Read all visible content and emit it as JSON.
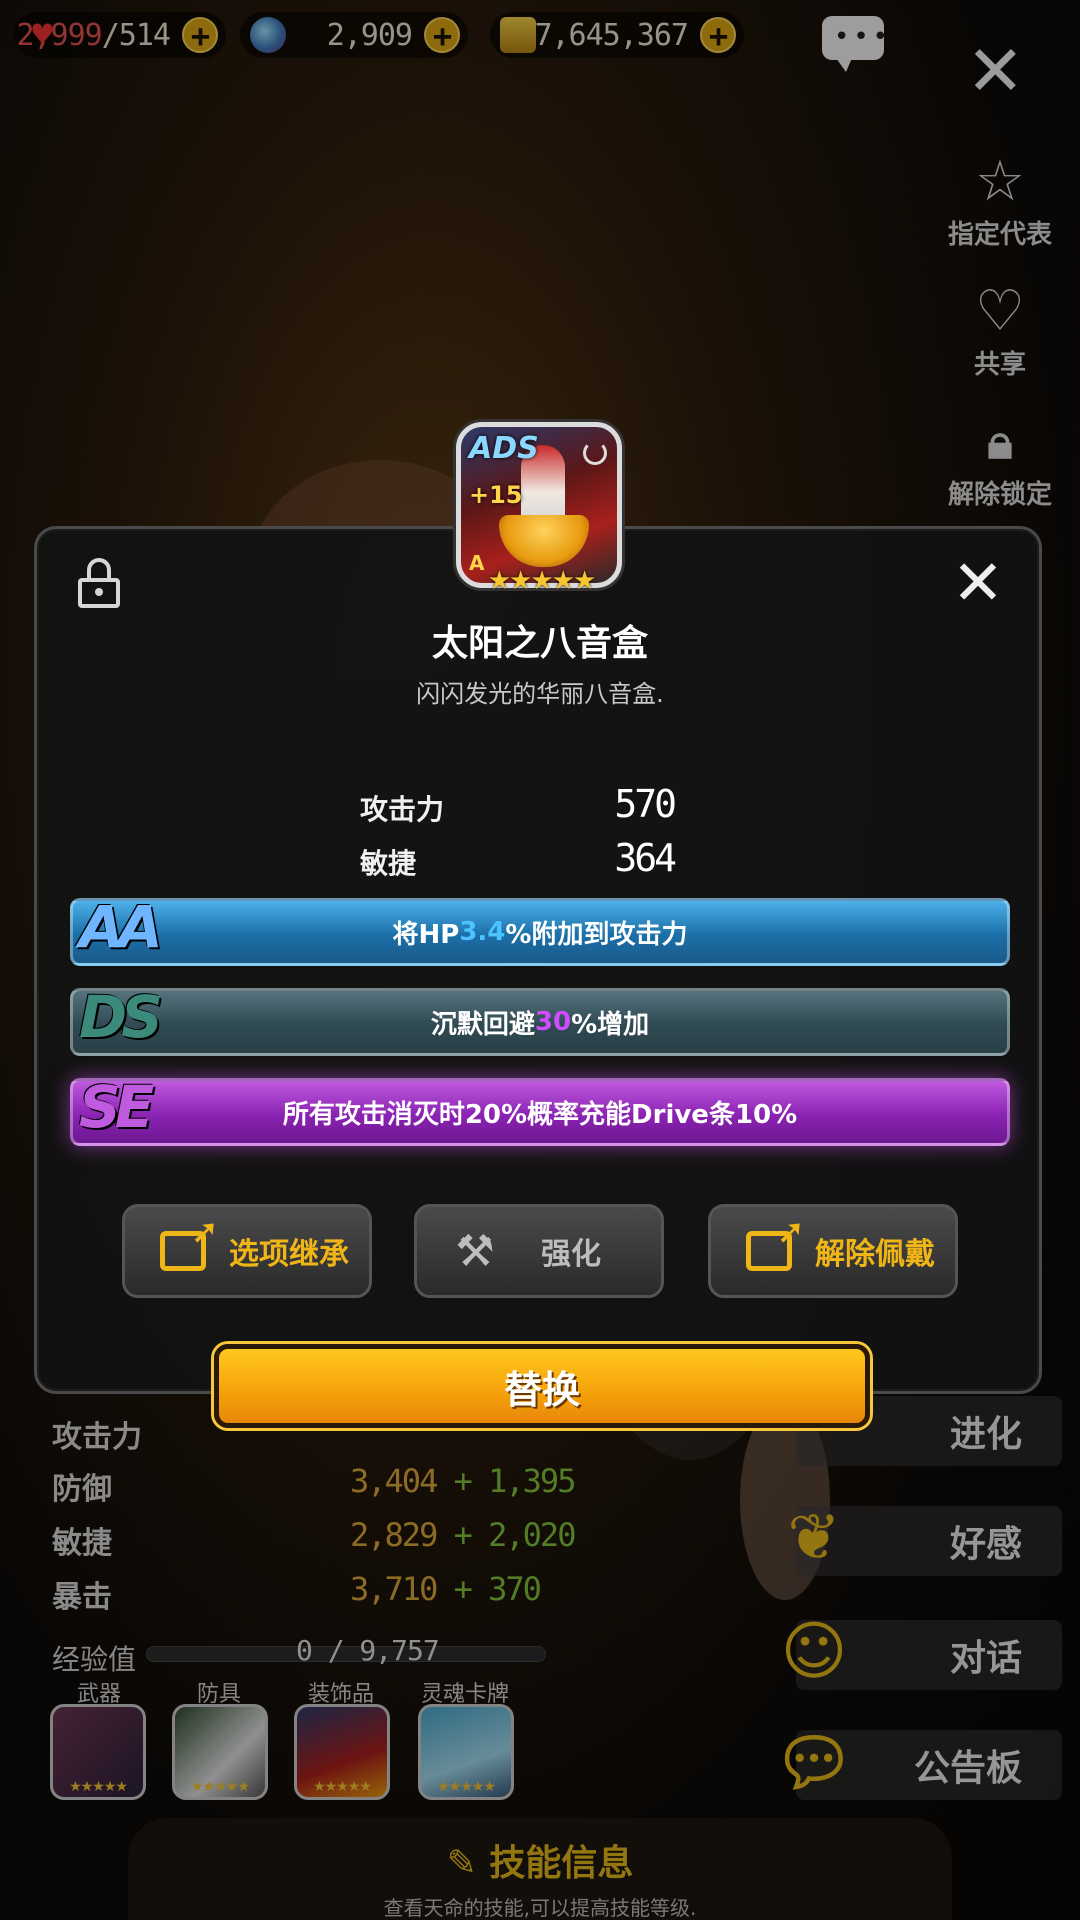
{
  "resources": {
    "stamina": "2,999",
    "stamina_max": "/514",
    "gems": "2,909",
    "gold": "7,645,367"
  },
  "side_menu": {
    "representative": "指定代表",
    "share": "共享",
    "unlock": "解除锁定"
  },
  "side_buttons": {
    "evolve": "进化",
    "affinity": "好感",
    "dialogue": "对话",
    "bulletin": "公告板"
  },
  "bg_stats": [
    {
      "label": "攻击力",
      "base": "",
      "bonus": ""
    },
    {
      "label": "防御",
      "base": "3,404",
      "bonus": "1,395"
    },
    {
      "label": "敏捷",
      "base": "2,829",
      "bonus": "2,020"
    },
    {
      "label": "暴击",
      "base": "3,710",
      "bonus": "370"
    }
  ],
  "exp": {
    "label": "经验值",
    "value": "0 / 9,757",
    "fill": 0
  },
  "equipment": {
    "weapon": "武器",
    "armor": "防具",
    "accessory": "装饰品",
    "soul_card": "灵魂卡牌"
  },
  "skill_info": {
    "title": "技能信息",
    "subtitle": "查看天命的技能,可以提高技能等级."
  },
  "item": {
    "rank": "ADS",
    "enhance": "+15",
    "grade": "A",
    "stars": "★★★★★",
    "name": "太阳之八音盒",
    "description": "闪闪发光的华丽八音盒.",
    "stats": [
      {
        "label": "攻击力",
        "value": "570"
      },
      {
        "label": "敏捷",
        "value": "364"
      }
    ]
  },
  "options": {
    "aa": {
      "badge": "AA",
      "pre": "将HP",
      "highlight": "3.4",
      "post": "%附加到攻击力"
    },
    "ds": {
      "badge": "DS",
      "pre": "沉默回避",
      "highlight": "30",
      "post": "%增加"
    },
    "se": {
      "badge": "SE",
      "text": "所有攻击消灭时20%概率充能Drive条10%"
    }
  },
  "actions": {
    "inherit": "选项继承",
    "enhance": "强化",
    "unequip": "解除佩戴",
    "replace": "替换"
  },
  "colors": {
    "gold": "#f0b516",
    "option_aa": "#1b6fa8",
    "option_ds": "#2f4a53",
    "option_se": "#8b23b3",
    "replace_button": "#f5a10a"
  }
}
